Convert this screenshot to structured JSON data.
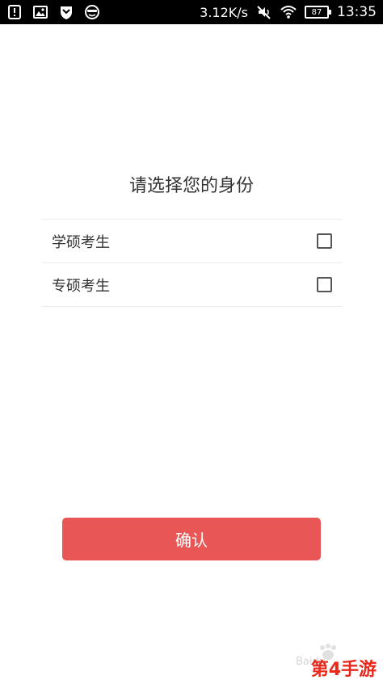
{
  "status_bar": {
    "net_speed": "3.12K/s",
    "battery": "87",
    "time": "13:35"
  },
  "page": {
    "title": "请选择您的身份",
    "options": [
      {
        "label": "学硕考生",
        "checked": false
      },
      {
        "label": "专硕考生",
        "checked": false
      }
    ],
    "confirm_label": "确认"
  },
  "watermark": {
    "baidu_text": "Baidu",
    "site_text": "第4手游"
  },
  "colors": {
    "accent": "#e95656",
    "status_bar_bg": "#000000",
    "text": "#333333"
  }
}
